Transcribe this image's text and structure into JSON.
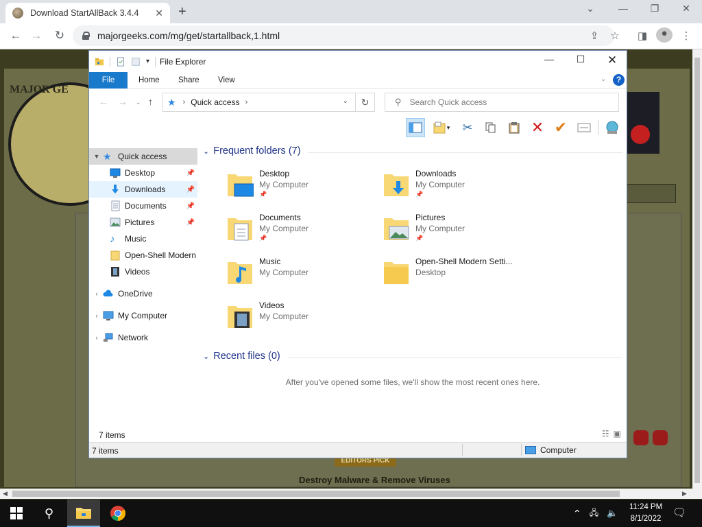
{
  "browser": {
    "tab_title": "Download StartAllBack 3.4.4",
    "url": "majorgeeks.com/mg/get/startallback,1.html"
  },
  "page": {
    "logo_text": "MAJOR GE",
    "editors_pick": "EDITORS PICK",
    "footer_text": "Destroy Malware & Remove Viruses"
  },
  "explorer": {
    "title": "File Explorer",
    "ribbon_tabs": [
      "File",
      "Home",
      "Share",
      "View"
    ],
    "address": {
      "crumb": "Quick access"
    },
    "search_placeholder": "Search Quick access",
    "nav": [
      {
        "label": "Quick access",
        "icon": "star-icon",
        "pinned": false
      },
      {
        "label": "Desktop",
        "icon": "desktop-icon",
        "pinned": true
      },
      {
        "label": "Downloads",
        "icon": "download-icon",
        "pinned": true
      },
      {
        "label": "Documents",
        "icon": "documents-icon",
        "pinned": true
      },
      {
        "label": "Pictures",
        "icon": "pictures-icon",
        "pinned": true
      },
      {
        "label": "Music",
        "icon": "music-icon",
        "pinned": false
      },
      {
        "label": "Open-Shell Modern",
        "icon": "folder-icon",
        "pinned": false
      },
      {
        "label": "Videos",
        "icon": "videos-icon",
        "pinned": false
      },
      {
        "label": "OneDrive",
        "icon": "cloud-icon",
        "pinned": false
      },
      {
        "label": "My Computer",
        "icon": "computer-icon",
        "pinned": false
      },
      {
        "label": "Network",
        "icon": "network-icon",
        "pinned": false
      }
    ],
    "frequent_header": "Frequent folders (7)",
    "folders": [
      {
        "name": "Desktop",
        "location": "My Computer",
        "pinned": true
      },
      {
        "name": "Downloads",
        "location": "My Computer",
        "pinned": true
      },
      {
        "name": "Documents",
        "location": "My Computer",
        "pinned": true
      },
      {
        "name": "Pictures",
        "location": "My Computer",
        "pinned": true
      },
      {
        "name": "Music",
        "location": "My Computer",
        "pinned": false
      },
      {
        "name": "Open-Shell Modern Setti...",
        "location": "Desktop",
        "pinned": false
      },
      {
        "name": "Videos",
        "location": "My Computer",
        "pinned": false
      }
    ],
    "recent_header": "Recent files (0)",
    "recent_message": "After you've opened some files, we'll show the most recent ones here.",
    "status_items": "7 items",
    "status_items_2": "7 items",
    "status_location": "Computer"
  },
  "taskbar": {
    "time": "11:24 PM",
    "date": "8/1/2022"
  },
  "colors": {
    "ribbon_file": "#1979ca",
    "header_blue": "#1e3287",
    "folder_yellow": "#f8d775"
  }
}
